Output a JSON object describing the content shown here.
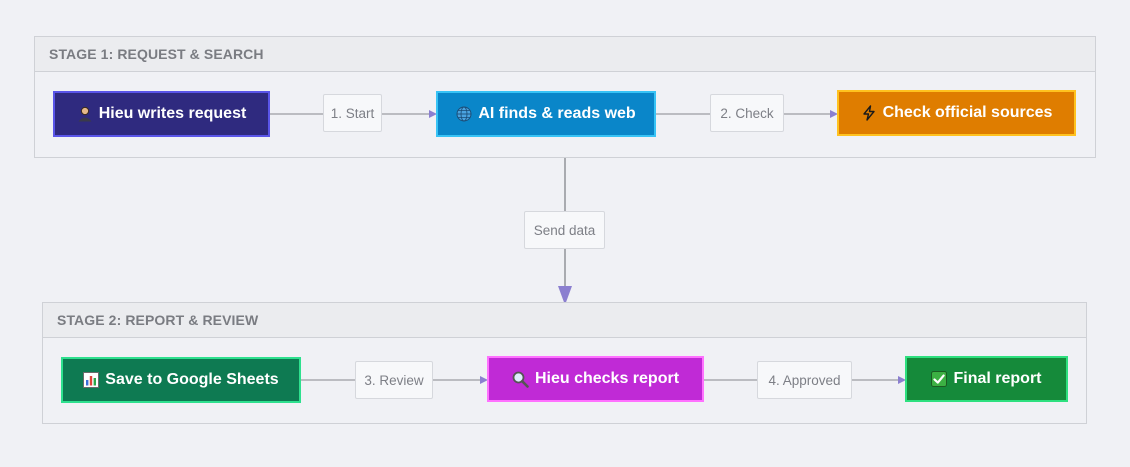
{
  "stages": [
    {
      "title": "STAGE 1: REQUEST & SEARCH",
      "nodes": [
        {
          "label": "Hieu writes request",
          "icon": "person-icon"
        },
        {
          "label": "AI finds & reads web",
          "icon": "globe-icon"
        },
        {
          "label": "Check official sources",
          "icon": "lightning-icon"
        }
      ],
      "edges": [
        "1. Start",
        "2. Check"
      ]
    },
    {
      "title": "STAGE 2: REPORT & REVIEW",
      "nodes": [
        {
          "label": "Save to Google Sheets",
          "icon": "bar-chart-icon"
        },
        {
          "label": "Hieu checks report",
          "icon": "magnifier-icon"
        },
        {
          "label": "Final report",
          "icon": "checkmark-icon"
        }
      ],
      "edges": [
        "3. Review",
        "4. Approved"
      ]
    }
  ],
  "connector": {
    "label": "Send data"
  },
  "colors": {
    "node_request": "#2f2a7f",
    "node_web": "#0a86c9",
    "node_sources": "#df7d00",
    "node_sheets": "#0e7a52",
    "node_check": "#c02ad6",
    "node_final": "#158a3a",
    "edge_line": "#a9abb0",
    "arrowhead": "#8b7fd0"
  }
}
